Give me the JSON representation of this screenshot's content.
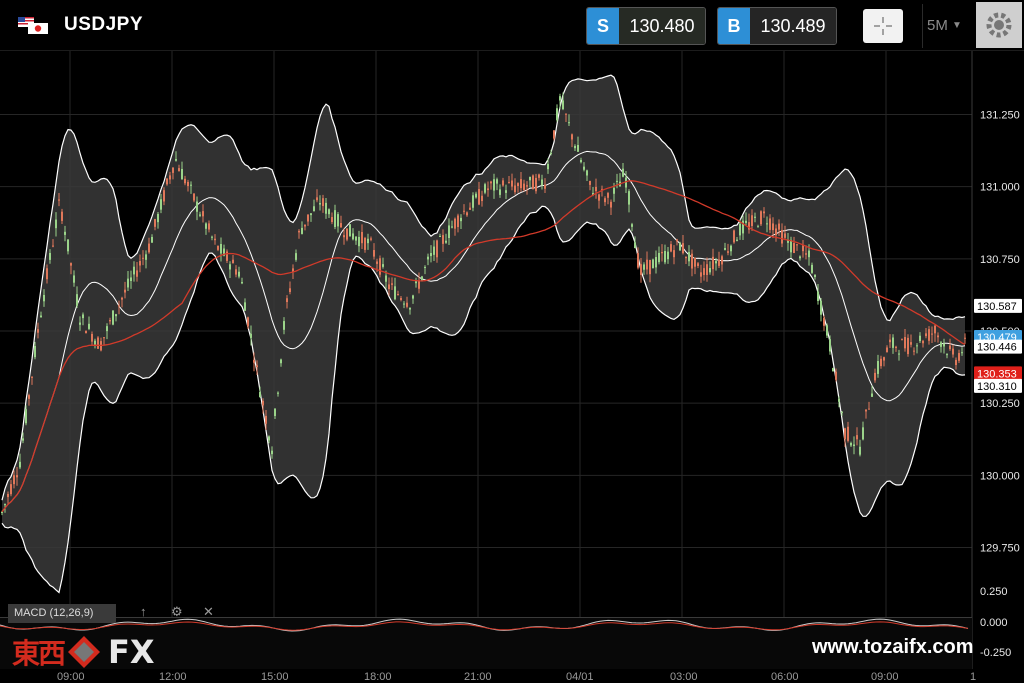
{
  "header": {
    "symbol": "USDJPY",
    "sell_tag": "S",
    "sell_price": "130.480",
    "buy_tag": "B",
    "buy_price": "130.489",
    "timeframe": "5M"
  },
  "price_axis": {
    "ticks": [
      "131.250",
      "131.000",
      "130.750",
      "130.500",
      "130.250",
      "130.000",
      "129.750"
    ],
    "ymin": 129.62,
    "ymax": 131.47,
    "price_tags": [
      {
        "value": "130.587",
        "price": 130.587,
        "bg": "#ffffff",
        "fg": "#000000"
      },
      {
        "value": "130.479",
        "price": 130.479,
        "bg": "#3fa0e0",
        "fg": "#ffffff"
      },
      {
        "value": "130.446",
        "price": 130.446,
        "bg": "#ffffff",
        "fg": "#000000"
      },
      {
        "value": "130.353",
        "price": 130.353,
        "bg": "#e0201a",
        "fg": "#ffffff"
      },
      {
        "value": "130.310",
        "price": 130.31,
        "bg": "#ffffff",
        "fg": "#000000"
      }
    ]
  },
  "time_axis": {
    "labels": [
      "09:00",
      "12:00",
      "15:00",
      "18:00",
      "21:00",
      "04/01",
      "03:00",
      "06:00",
      "09:00",
      "1"
    ]
  },
  "macd": {
    "label": "MACD (12,26,9)",
    "ticks": [
      "0.250",
      "0.000",
      "-0.250"
    ]
  },
  "colors": {
    "up_candle": "#9bd48a",
    "down_candle": "#e0785a",
    "ma_red": "#d23a2a",
    "band_white": "#ffffff",
    "band_fill": "#3a3a3a",
    "accent_blue": "#2d8fd6"
  },
  "watermark": {
    "logo_kanji": "東西",
    "logo_fx": "FX",
    "url": "www.tozaifx.com"
  }
}
